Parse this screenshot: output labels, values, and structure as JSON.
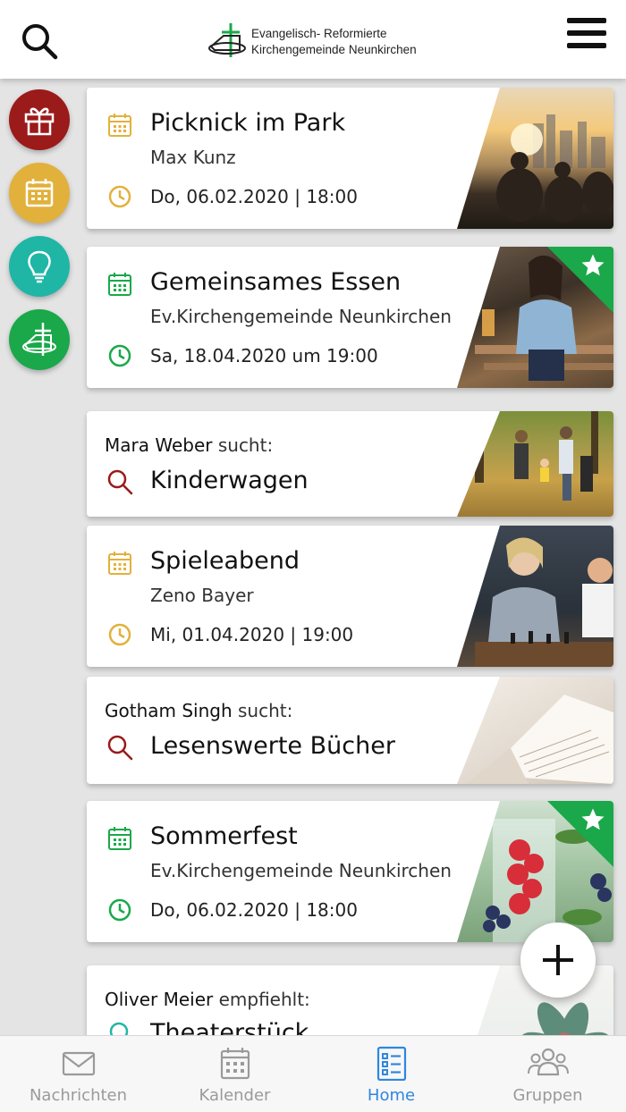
{
  "header": {
    "logo_line1": "Evangelisch- Reformierte",
    "logo_line2": "Kirchengemeinde Neunkirchen"
  },
  "side_actions": [
    {
      "name": "gift-icon",
      "color": "#9b1a1a"
    },
    {
      "name": "calendar-icon",
      "color": "#e2b13c"
    },
    {
      "name": "lightbulb-icon",
      "color": "#1fb6a6"
    },
    {
      "name": "church-icon",
      "color": "#1aa84a"
    }
  ],
  "feed": [
    {
      "type": "event",
      "title": "Picknick im Park",
      "organizer": "Max Kunz",
      "date": "Do, 06.02.2020 | 18:00",
      "accent": "#e2b13c",
      "featured": false
    },
    {
      "type": "event",
      "title": "Gemeinsames Essen",
      "organizer": "Ev.Kirchengemeinde Neunkirchen",
      "date": "Sa, 18.04.2020 um 19:00",
      "accent": "#1aa84a",
      "featured": true
    },
    {
      "type": "search",
      "person": "Mara Weber",
      "verb": "sucht:",
      "title": "Kinderwagen",
      "accent": "#9b1a1a"
    },
    {
      "type": "event",
      "title": "Spieleabend",
      "organizer": "Zeno Bayer",
      "date": "Mi, 01.04.2020 | 19:00",
      "accent": "#e2b13c",
      "featured": false
    },
    {
      "type": "search",
      "person": "Gotham Singh",
      "verb": "sucht:",
      "title": "Lesenswerte Bücher",
      "accent": "#9b1a1a"
    },
    {
      "type": "event",
      "title": "Sommerfest",
      "organizer": "Ev.Kirchengemeinde Neunkirchen",
      "date": "Do, 06.02.2020 | 18:00",
      "accent": "#1aa84a",
      "featured": true
    },
    {
      "type": "recommend",
      "person": "Oliver Meier",
      "verb": "empfiehlt:",
      "title": "Theaterstück",
      "accent": "#1fb6a6"
    }
  ],
  "tabs": [
    {
      "label": "Nachrichten",
      "icon": "envelope-icon",
      "active": false
    },
    {
      "label": "Kalender",
      "icon": "calendar-icon",
      "active": false
    },
    {
      "label": "Home",
      "icon": "list-icon",
      "active": true
    },
    {
      "label": "Gruppen",
      "icon": "group-icon",
      "active": false
    }
  ],
  "colors": {
    "active_tab": "#2f86e0",
    "inactive_tab": "#9a9a9a"
  }
}
